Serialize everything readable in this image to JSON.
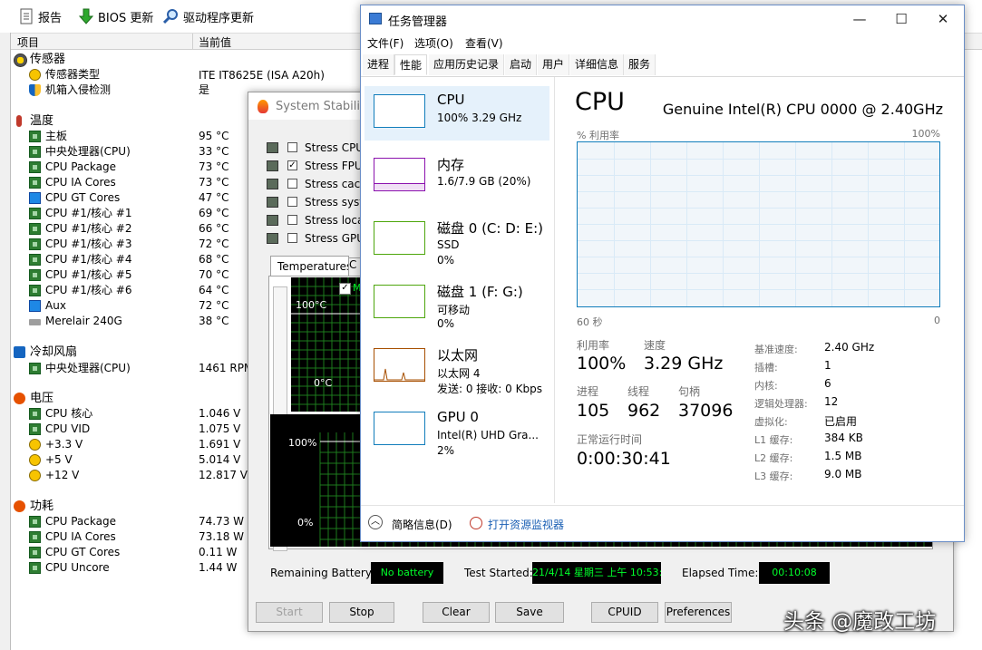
{
  "aida": {
    "toolbar": {
      "report": "报告",
      "bios_update": "BIOS 更新",
      "driver_update": "驱动程序更新"
    },
    "columns": {
      "item": "项目",
      "value": "当前值"
    },
    "sensors_cat": "传感器",
    "sensor_type_label": "传感器类型",
    "sensor_type_value": "ITE IT8625E  (ISA A20h)",
    "chassis_label": "机箱入侵检测",
    "chassis_value": "是",
    "temp_cat": "温度",
    "temps": [
      {
        "label": "主板",
        "value": "95 °C",
        "icon": "chip-icon"
      },
      {
        "label": "中央处理器(CPU)",
        "value": "33 °C",
        "icon": "chip-icon"
      },
      {
        "label": "CPU Package",
        "value": "73 °C",
        "icon": "chip-icon"
      },
      {
        "label": "CPU IA Cores",
        "value": "73 °C",
        "icon": "chip-icon"
      },
      {
        "label": "CPU GT Cores",
        "value": "47 °C",
        "icon": "gpu-icon"
      },
      {
        "label": "CPU #1/核心 #1",
        "value": "69 °C",
        "icon": "chip-icon"
      },
      {
        "label": "CPU #1/核心 #2",
        "value": "66 °C",
        "icon": "chip-icon"
      },
      {
        "label": "CPU #1/核心 #3",
        "value": "72 °C",
        "icon": "chip-icon"
      },
      {
        "label": "CPU #1/核心 #4",
        "value": "68 °C",
        "icon": "chip-icon"
      },
      {
        "label": "CPU #1/核心 #5",
        "value": "70 °C",
        "icon": "chip-icon"
      },
      {
        "label": "CPU #1/核心 #6",
        "value": "64 °C",
        "icon": "chip-icon"
      },
      {
        "label": "Aux",
        "value": "72 °C",
        "icon": "gpu-icon"
      },
      {
        "label": "Merelair 240G",
        "value": "38 °C",
        "icon": "disk-icon"
      }
    ],
    "fan_cat": "冷却风扇",
    "fan_label": "中央处理器(CPU)",
    "fan_value": "1461 RPM",
    "volt_cat": "电压",
    "volts": [
      {
        "label": "CPU 核心",
        "value": "1.046 V",
        "icon": "chip-icon"
      },
      {
        "label": "CPU VID",
        "value": "1.075 V",
        "icon": "chip-icon"
      },
      {
        "label": "+3.3 V",
        "value": "1.691 V",
        "icon": "plus-icon"
      },
      {
        "label": "+5 V",
        "value": "5.014 V",
        "icon": "plus-icon"
      },
      {
        "label": "+12 V",
        "value": "12.817 V",
        "icon": "plus-icon"
      }
    ],
    "power_cat": "功耗",
    "powers": [
      {
        "label": "CPU Package",
        "value": "74.73 W",
        "icon": "chip-icon"
      },
      {
        "label": "CPU IA Cores",
        "value": "73.18 W",
        "icon": "chip-icon"
      },
      {
        "label": "CPU GT Cores",
        "value": "0.11 W",
        "icon": "chip-icon"
      },
      {
        "label": "CPU Uncore",
        "value": "1.44 W",
        "icon": "chip-icon"
      }
    ]
  },
  "stability": {
    "title": "System Stability",
    "stress": [
      "Stress CPU",
      "Stress FPU",
      "Stress cache",
      "Stress syster",
      "Stress local",
      "Stress GPU(s"
    ],
    "stress_checked": [
      false,
      true,
      false,
      false,
      false,
      false
    ],
    "tab_temps": "Temperatures",
    "tab_other": "C",
    "temp_hi": "100°C",
    "temp_lo": "0°C",
    "usage_hi": "100%",
    "usage_lo": "0%",
    "graph_check_letter": "M",
    "remaining_label": "Remaining Battery:",
    "remaining_value": "No battery",
    "started_label": "Test Started:",
    "started_value": "21/4/14 星期三 上午 10:53:",
    "elapsed_label": "Elapsed Time:",
    "elapsed_value": "00:10:08",
    "buttons": {
      "start": "Start",
      "stop": "Stop",
      "clear": "Clear",
      "save": "Save",
      "cpuid": "CPUID",
      "prefs": "Preferences"
    }
  },
  "tm": {
    "title": "任务管理器",
    "menu": [
      "文件(F)",
      "选项(O)",
      "查看(V)"
    ],
    "tabs": [
      "进程",
      "性能",
      "应用历史记录",
      "启动",
      "用户",
      "详细信息",
      "服务"
    ],
    "resources": [
      {
        "name": "CPU",
        "s1": "100% 3.29 GHz",
        "s2": "",
        "color": "#117dbb"
      },
      {
        "name": "内存",
        "s1": "1.6/7.9 GB (20%)",
        "s2": "",
        "color": "#8b12ae"
      },
      {
        "name": "磁盘 0 (C: D: E:)",
        "s1": "SSD",
        "s2": "0%",
        "color": "#4da60c"
      },
      {
        "name": "磁盘 1 (F: G:)",
        "s1": "可移动",
        "s2": "0%",
        "color": "#4da60c"
      },
      {
        "name": "以太网",
        "s1": "以太网 4",
        "s2": "发送: 0 接收: 0 Kbps",
        "color": "#a74f01"
      },
      {
        "name": "GPU 0",
        "s1": "Intel(R) UHD Gra...",
        "s2": "2%",
        "color": "#117dbb"
      }
    ],
    "cpu_title": "CPU",
    "cpu_model": "Genuine Intel(R) CPU 0000 @ 2.40GHz",
    "graph_y_label": "% 利用率",
    "graph_y_max": "100%",
    "graph_x_label": "60 秒",
    "graph_x_min": "0",
    "util_label": "利用率",
    "util_value": "100%",
    "speed_label": "速度",
    "speed_value": "3.29 GHz",
    "proc_label": "进程",
    "proc_value": "105",
    "thread_label": "线程",
    "thread_value": "962",
    "handle_label": "句柄",
    "handle_value": "37096",
    "uptime_label": "正常运行时间",
    "uptime_value": "0:00:30:41",
    "specs": [
      {
        "k": "基准速度:",
        "v": "2.40 GHz"
      },
      {
        "k": "插槽:",
        "v": "1"
      },
      {
        "k": "内核:",
        "v": "6"
      },
      {
        "k": "逻辑处理器:",
        "v": "12"
      },
      {
        "k": "虚拟化:",
        "v": "已启用"
      },
      {
        "k": "L1 缓存:",
        "v": "384 KB"
      },
      {
        "k": "L2 缓存:",
        "v": "1.5 MB"
      },
      {
        "k": "L3 缓存:",
        "v": "9.0 MB"
      }
    ],
    "footer_brief": "简略信息(D)",
    "footer_monitor": "打开资源监视器"
  },
  "watermark": "头条 @魔改工坊"
}
